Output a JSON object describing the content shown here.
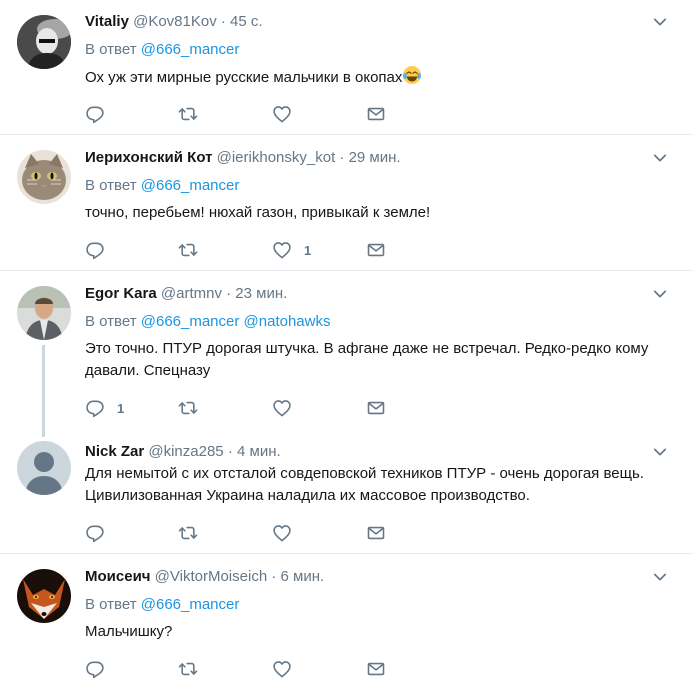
{
  "reply_prefix": "В ответ",
  "tweets": [
    {
      "name": "Vitaliy",
      "handle": "@Kov81Kov",
      "time": "· 45 с.",
      "reply_to": [
        "@666_mancer"
      ],
      "text": "Ох уж эти мирные  русские мальчики в окопах",
      "emoji": "face-with-tears-of-joy",
      "counts": {
        "reply": "",
        "retweet": "",
        "like": "",
        "message": ""
      }
    },
    {
      "name": "Иерихонский Кот",
      "handle": "@ierikhonsky_kot",
      "time": "· 29 мин.",
      "reply_to": [
        "@666_mancer"
      ],
      "text": "точно, перебьем! нюхай газон, привыкай к земле!",
      "counts": {
        "reply": "",
        "retweet": "",
        "like": "1",
        "message": ""
      }
    },
    {
      "name": "Egor Kara",
      "handle": "@artmnv",
      "time": "· 23 мин.",
      "reply_to": [
        "@666_mancer",
        "@natohawks"
      ],
      "text": "Это точно. ПТУР дорогая штучка. В афгане даже не встречал. Редко-редко кому давали. Спецназу",
      "counts": {
        "reply": "1",
        "retweet": "",
        "like": "",
        "message": ""
      }
    },
    {
      "name": "Nick Zar",
      "handle": "@kinza285",
      "time": "· 4 мин.",
      "reply_to": [],
      "text": "Для немытой с их отсталой совдеповской техников ПТУР - очень дорогая вещь. Цивилизованная Украина наладила их массовое производство.",
      "counts": {
        "reply": "",
        "retweet": "",
        "like": "",
        "message": ""
      }
    },
    {
      "name": "Моисеич",
      "handle": "@ViktorMoiseich",
      "time": "· 6 мин.",
      "reply_to": [
        "@666_mancer"
      ],
      "text": "Мальчишку?",
      "counts": {
        "reply": "",
        "retweet": "",
        "like": "",
        "message": ""
      }
    }
  ],
  "colors": {
    "accent": "#1b95e0",
    "muted": "#657786",
    "text": "#14171a",
    "border": "#e6ecf0"
  }
}
